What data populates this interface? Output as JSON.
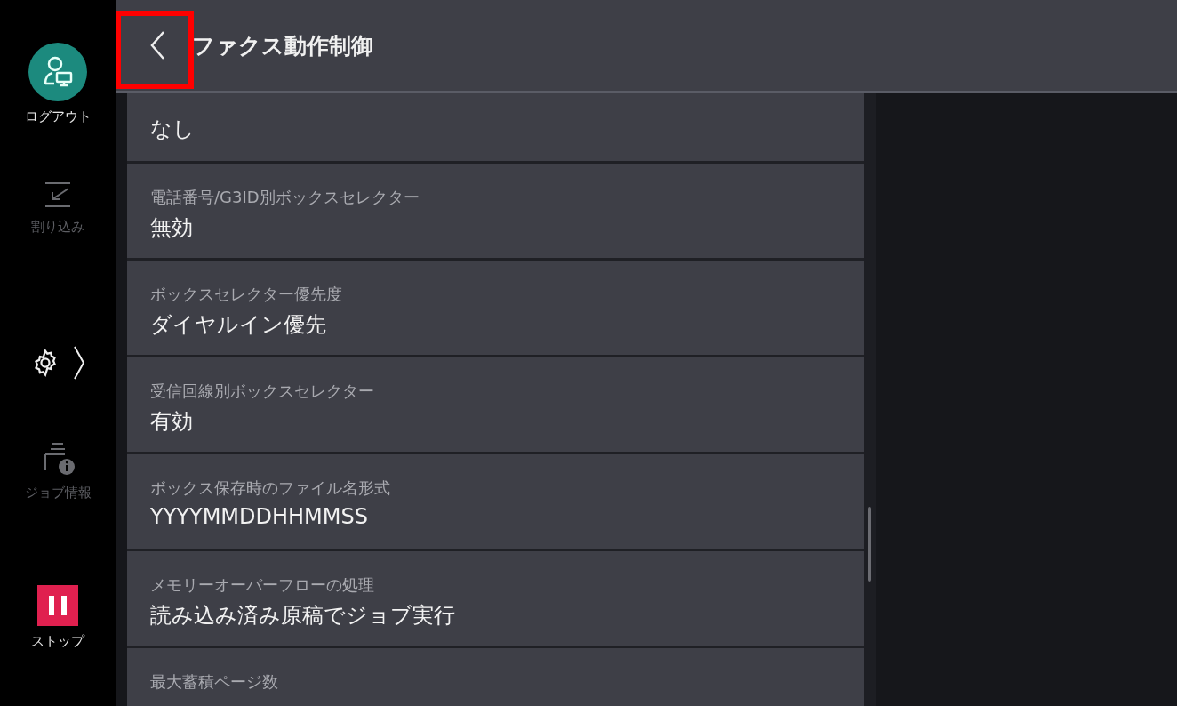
{
  "sidebar": {
    "items": [
      {
        "kind": "logout",
        "label": "ログアウト",
        "disabled": false
      },
      {
        "kind": "interrupt",
        "label": "割り込み",
        "disabled": true
      },
      {
        "kind": "settings"
      },
      {
        "kind": "job_info",
        "label": "ジョブ情報",
        "disabled": true
      },
      {
        "kind": "stop",
        "label": "ストップ",
        "disabled": false
      }
    ]
  },
  "header": {
    "title": "ファクス動作制御",
    "back_highlighted": true
  },
  "settings": [
    {
      "value": "なし"
    },
    {
      "label": "電話番号/G3ID別ボックスセレクター",
      "value": "無効"
    },
    {
      "label": "ボックスセレクター優先度",
      "value": "ダイヤルイン優先"
    },
    {
      "label": "受信回線別ボックスセレクター",
      "value": "有効"
    },
    {
      "label": "ボックス保存時のファイル名形式",
      "value": "YYYYMMDDHHMMSS"
    },
    {
      "label": "メモリーオーバーフローの処理",
      "value": "読み込み済み原稿でジョブ実行"
    },
    {
      "label": "最大蓄積ページ数"
    }
  ]
}
